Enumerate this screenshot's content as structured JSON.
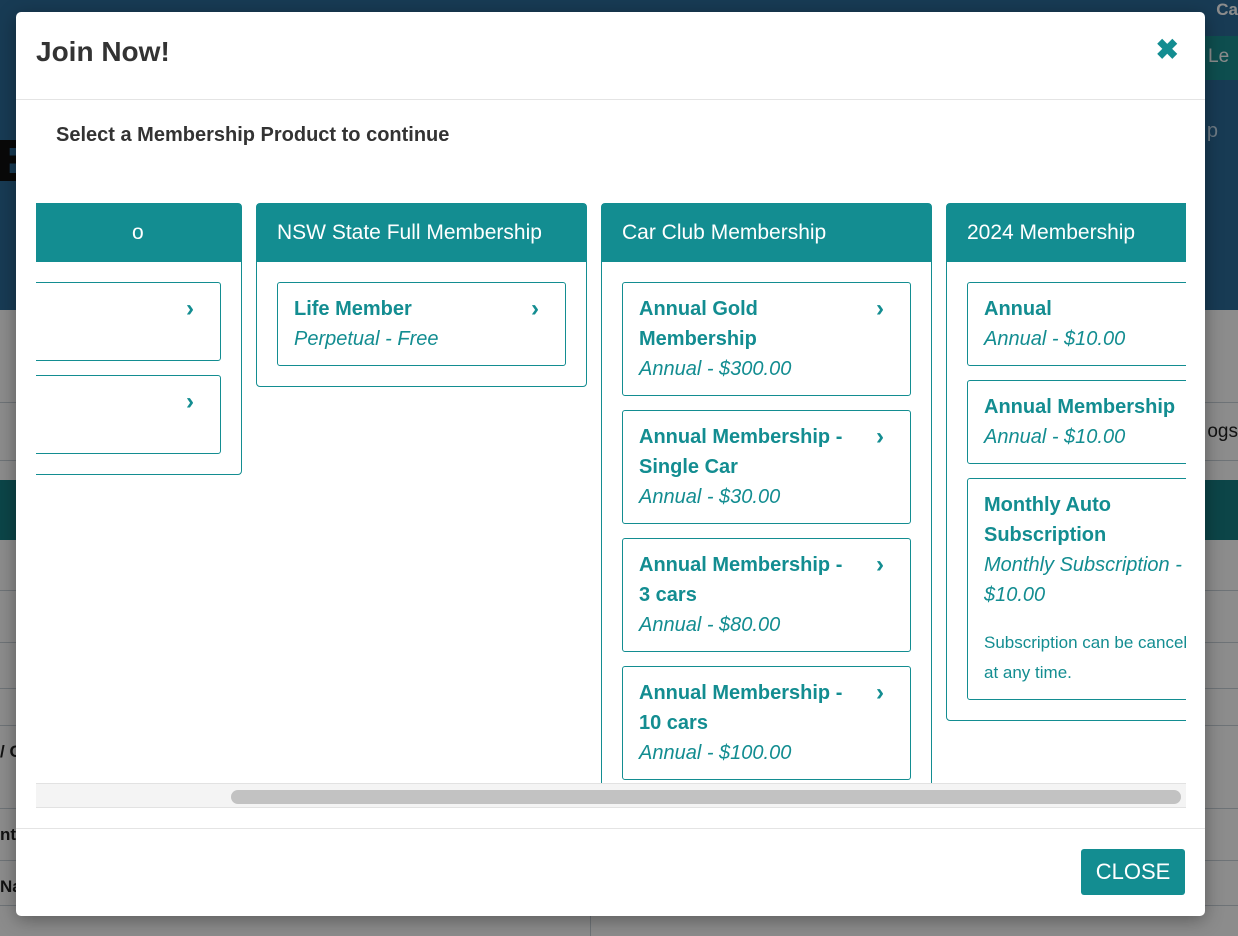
{
  "background": {
    "top_right_text": "Ca",
    "login_text": "Le",
    "help_text": "p",
    "logo_fragment": "E",
    "logs_text": "ogs",
    "left_fragments": [
      "/ C",
      "nt",
      "Na"
    ]
  },
  "modal": {
    "title": "Join Now!",
    "subtitle": "Select a Membership Product to continue",
    "close_label": "CLOSE",
    "columns": [
      {
        "title": "o",
        "products": [
          {
            "name": "",
            "price": ""
          },
          {
            "name": "",
            "price": ""
          }
        ]
      },
      {
        "title": "NSW State Full Membership",
        "products": [
          {
            "name": "Life Member",
            "price": "Perpetual - Free"
          }
        ]
      },
      {
        "title": "Car Club Membership",
        "products": [
          {
            "name": "Annual Gold Membership",
            "price": "Annual - $300.00"
          },
          {
            "name": "Annual Membership - Single Car",
            "price": "Annual - $30.00"
          },
          {
            "name": "Annual Membership - 3 cars",
            "price": "Annual - $80.00"
          },
          {
            "name": "Annual Membership - 10 cars",
            "price": "Annual - $100.00"
          }
        ]
      },
      {
        "title": "2024 Membership",
        "products": [
          {
            "name": "Annual",
            "price": "Annual - $10.00"
          },
          {
            "name": "Annual Membership",
            "price": "Annual - $10.00"
          },
          {
            "name": "Monthly Auto Subscription",
            "price": "Monthly Subscription - $10.00",
            "note": "Subscription can be cancelled at any time."
          }
        ]
      }
    ]
  },
  "icons": {
    "close": "close-icon",
    "chevron": "chevron-right-icon"
  },
  "colors": {
    "accent": "#138d91",
    "header_bg": "#2c6c9a"
  }
}
